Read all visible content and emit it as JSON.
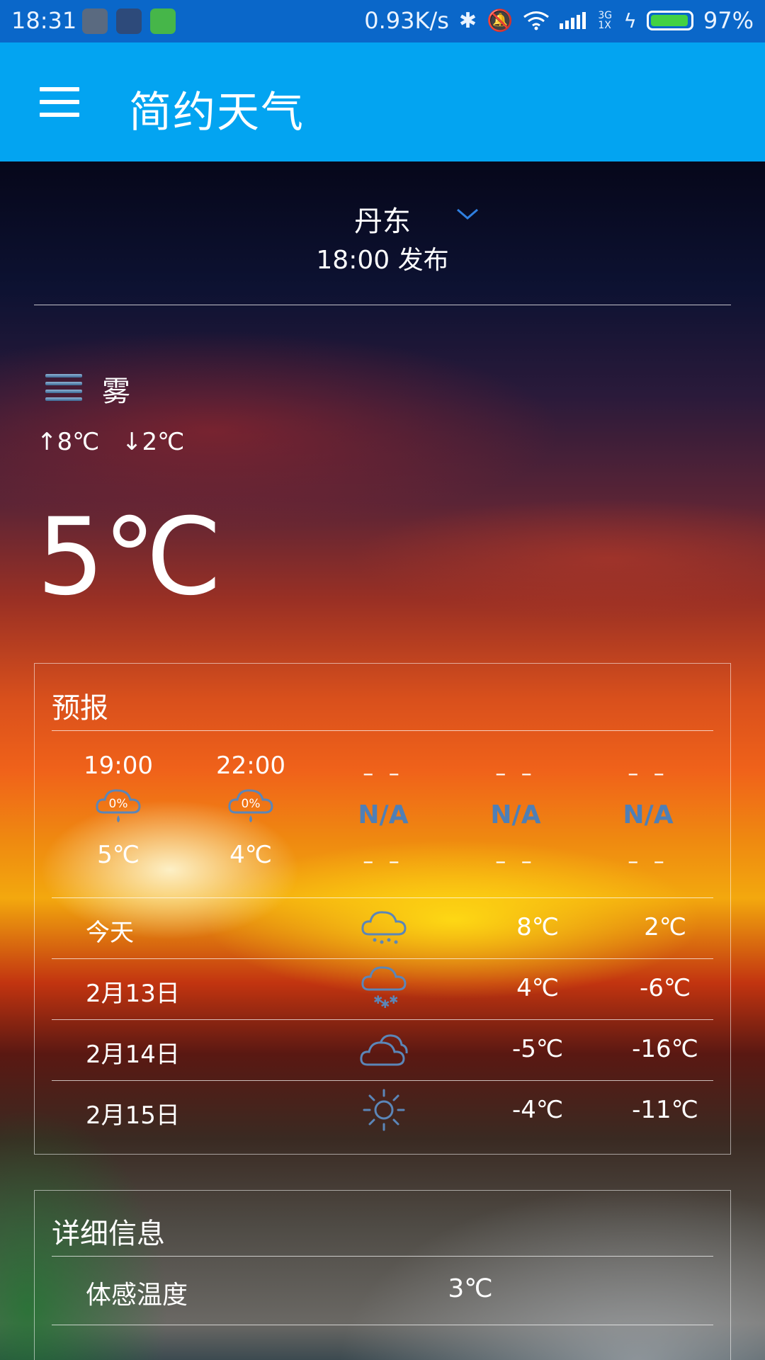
{
  "status_bar": {
    "time": "18:31",
    "speed": "0.93K/s",
    "network": "3G 1X",
    "battery_percent": "97%",
    "battery_level": 0.97
  },
  "app_bar": {
    "title": "简约天气",
    "menu_icon": "hamburger-menu-icon"
  },
  "location": {
    "city": "丹东",
    "published": "18:00 发布"
  },
  "current": {
    "condition": "雾",
    "condition_icon": "fog-icon",
    "high": "↑8℃",
    "low": "↓2℃",
    "temperature": "5℃"
  },
  "forecast": {
    "title": "预报",
    "hourly": [
      {
        "time": "19:00",
        "precip": "0%",
        "temp": "5℃",
        "icon": "rain-cloud-icon"
      },
      {
        "time": "22:00",
        "precip": "0%",
        "temp": "4℃",
        "icon": "rain-cloud-icon"
      },
      {
        "time": "– –",
        "na": "N/A",
        "temp": "– –"
      },
      {
        "time": "– –",
        "na": "N/A",
        "temp": "– –"
      },
      {
        "time": "– –",
        "na": "N/A",
        "temp": "– –"
      }
    ],
    "daily": [
      {
        "day": "今天",
        "icon": "light-snow-icon",
        "high": "8℃",
        "low": "2℃"
      },
      {
        "day": "2月13日",
        "icon": "snow-icon",
        "high": "4℃",
        "low": "-6℃"
      },
      {
        "day": "2月14日",
        "icon": "cloudy-icon",
        "high": "-5℃",
        "low": "-16℃"
      },
      {
        "day": "2月15日",
        "icon": "sunny-icon",
        "high": "-4℃",
        "low": "-11℃"
      }
    ]
  },
  "details": {
    "title": "详细信息",
    "rows": [
      {
        "label": "体感温度",
        "value": "3℃"
      }
    ]
  },
  "colors": {
    "status_bar": "#0a67c9",
    "app_bar": "#03a4f1",
    "na_text": "#4f7fb6",
    "icon_blue": "#5b86b8"
  }
}
